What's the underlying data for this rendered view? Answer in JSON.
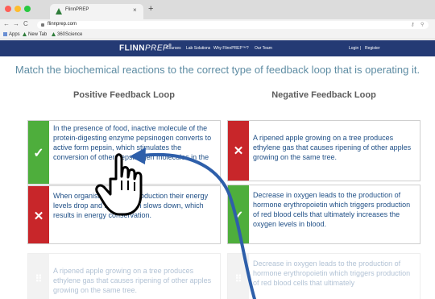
{
  "browser": {
    "tab_title": "FlinnPREP",
    "tab_close": "×",
    "new_tab": "+",
    "back": "←",
    "forward": "→",
    "reload": "C",
    "url": "flinnprep.com",
    "bookmarks": [
      "Apps",
      "New Tab",
      "360Science"
    ],
    "traffic_colors": [
      "#fe5f57",
      "#febc2e",
      "#28c840"
    ]
  },
  "site": {
    "logo_bold": "FLINN",
    "logo_light": "PREP",
    "logo_mark": "®",
    "nav": [
      "Courses",
      "Lab Solutions",
      "Why FlinnPREP™?",
      "Our Team",
      "Login",
      "|",
      "Register"
    ],
    "nav_color": "#243a74"
  },
  "activity": {
    "instruction": "Match the biochemical reactions to the correct type of feedback loop that is operating it.",
    "positive_heading": "Positive Feedback Loop",
    "negative_heading": "Negative Feedback Loop",
    "left_cards": [
      {
        "status": "correct",
        "icon": "check-icon",
        "text": "In the presence of food, inactive molecule of the protein-digesting enzyme pepsinogen converts to active form pepsin, which stimulates the conversion of other pepsinogen molecules in the"
      },
      {
        "status": "incorrect",
        "icon": "x-icon",
        "text": "When organisms reduce production their energy levels drop and metabolism slows down, which results in energy conservation."
      },
      {
        "status": "unplaced",
        "icon": "drag-handle-icon",
        "text": "A ripened apple growing on a tree produces ethylene gas that causes ripening of other apples growing on the same tree."
      }
    ],
    "right_cards": [
      {
        "status": "incorrect",
        "icon": "x-icon",
        "text": "A ripened apple growing on a tree produces ethylene gas that causes ripening of other apples growing on the same tree."
      },
      {
        "status": "correct",
        "icon": "check-icon",
        "text": "Decrease in oxygen leads to the production of hormone erythropoietin which triggers production of red blood cells that ultimately increases the oxygen levels in blood."
      },
      {
        "status": "unplaced",
        "icon": "drag-handle-icon",
        "text": "Decrease in oxygen leads to the production of hormone erythropoietin which triggers production of red blood cells that ultimately"
      }
    ],
    "status_colors": {
      "correct": "#4eae3c",
      "incorrect": "#c8262a",
      "unplaced": "#dcdcdc"
    },
    "text_color": "#1f4f86",
    "arrow_color": "#2e5faa"
  }
}
